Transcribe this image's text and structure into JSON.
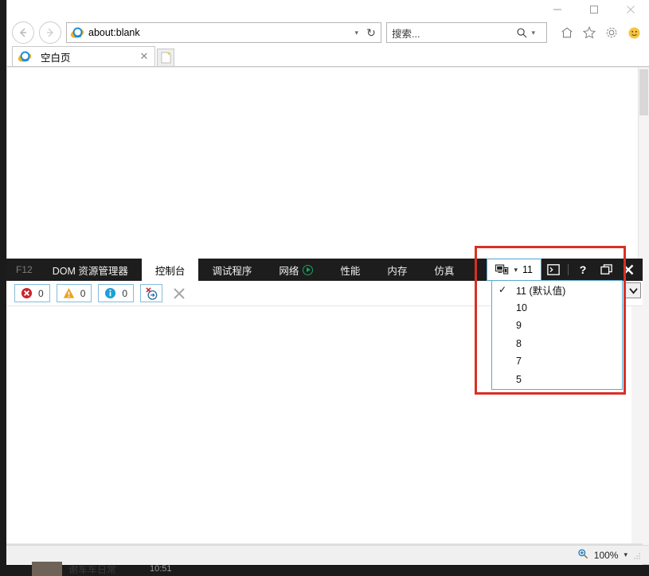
{
  "window": {
    "minimize_label": "—",
    "maximize_label": "☐",
    "close_label": "✕"
  },
  "nav": {
    "back_label": "←",
    "forward_label": "→",
    "address_value": "about:blank",
    "address_caret": "▾",
    "refresh_label": "↻",
    "search_placeholder": "搜索...",
    "search_caret": "▾",
    "home_icon": "home-icon",
    "favorites_icon": "star-icon",
    "settings_icon": "gear-icon",
    "smiley_icon": "smiley-icon"
  },
  "tabs": {
    "items": [
      {
        "title": "空白页",
        "close_label": "✕"
      }
    ],
    "new_tab_label": ""
  },
  "devtools": {
    "f12_label": "F12",
    "tabs": [
      {
        "label": "DOM 资源管理器",
        "active": false,
        "has_play": false
      },
      {
        "label": "控制台",
        "active": true,
        "has_play": false
      },
      {
        "label": "调试程序",
        "active": false,
        "has_play": false
      },
      {
        "label": "网络",
        "active": false,
        "has_play": true
      },
      {
        "label": "性能",
        "active": false,
        "has_play": false
      },
      {
        "label": "内存",
        "active": false,
        "has_play": false
      },
      {
        "label": "仿真",
        "active": false,
        "has_play": false
      }
    ],
    "docmode": {
      "value": "11",
      "caret": "▾",
      "icon": "emulation-device-icon"
    },
    "right_icons": [
      {
        "name": "console-window-icon",
        "glyph": "⋗"
      },
      {
        "name": "help-icon",
        "glyph": "?"
      },
      {
        "name": "undock-icon",
        "glyph": "❐"
      },
      {
        "name": "close-devtools-icon",
        "glyph": "✕"
      }
    ],
    "console_toolbar": {
      "errors": {
        "count": "0",
        "icon": "error-icon"
      },
      "warnings": {
        "count": "0",
        "icon": "warning-icon"
      },
      "infos": {
        "count": "0",
        "icon": "info-icon"
      },
      "clear_on_navigate_icon": "clear-on-navigate-icon",
      "clear_label": "✕"
    },
    "console_input": {
      "prompt": "›",
      "value": "",
      "placeholder": ""
    },
    "console_actions": [
      {
        "name": "clear-console-button",
        "glyph": "✕",
        "color": "normal"
      },
      {
        "name": "run-script-button",
        "glyph": "▶",
        "color": "green"
      },
      {
        "name": "expand-input-button",
        "glyph": "»",
        "color": "normal"
      }
    ],
    "scroll_button_label": "∨"
  },
  "document_mode_dropdown": {
    "check_glyph": "✓",
    "items": [
      {
        "label": "11 (默认值)",
        "checked": true
      },
      {
        "label": "10",
        "checked": false
      },
      {
        "label": "9",
        "checked": false
      },
      {
        "label": "8",
        "checked": false
      },
      {
        "label": "7",
        "checked": false
      },
      {
        "label": "5",
        "checked": false
      }
    ]
  },
  "statusbar": {
    "zoom_icon": "zoom-icon",
    "zoom_level": "100%",
    "zoom_caret": "▾"
  },
  "background": {
    "taskbar_title": "谢车车日常",
    "taskbar_time": "10:51"
  },
  "colors": {
    "accent_blue": "#4fa3d1",
    "annotation_red": "#d93025",
    "devtools_dark": "#1d1d1d",
    "green": "#1aa260"
  }
}
